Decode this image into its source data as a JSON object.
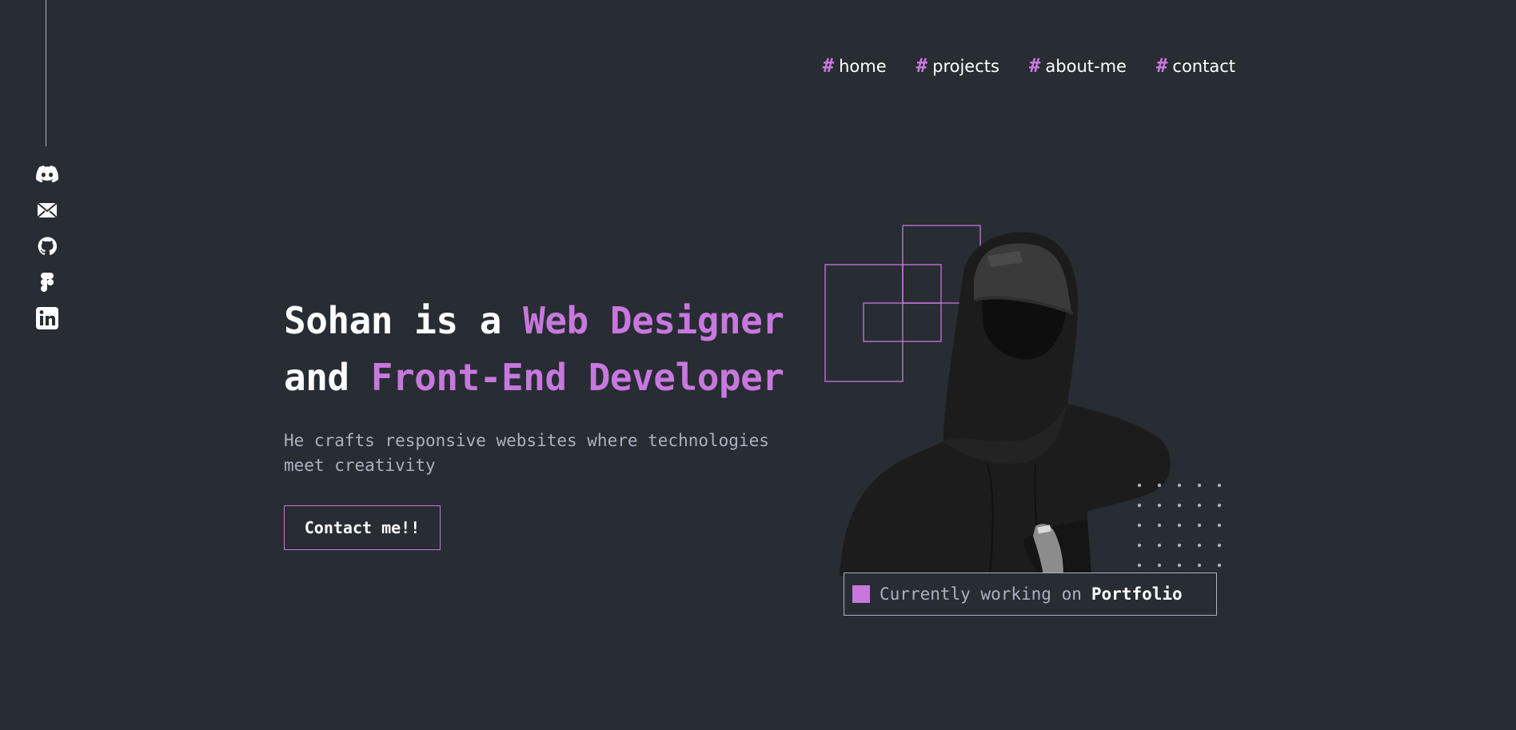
{
  "colors": {
    "background": "#282c33",
    "accent": "#c778dd",
    "text": "#ffffff",
    "muted": "#abb2bf"
  },
  "socials": [
    {
      "icon": "discord-icon"
    },
    {
      "icon": "mail-icon"
    },
    {
      "icon": "github-icon"
    },
    {
      "icon": "figma-icon"
    },
    {
      "icon": "linkedin-icon"
    }
  ],
  "nav": {
    "hash": "#",
    "items": [
      {
        "label": "home"
      },
      {
        "label": "projects"
      },
      {
        "label": "about-me"
      },
      {
        "label": "contact"
      }
    ]
  },
  "hero": {
    "line1_plain": "Sohan is a ",
    "line1_accent": "Web Designer",
    "line2_plain": "and ",
    "line2_accent": "Front-End Developer",
    "subtext": "He crafts responsive websites where technologies meet creativity",
    "cta_label": "Contact me!!"
  },
  "status": {
    "prefix": "Currently working on",
    "project": "Portfolio"
  }
}
